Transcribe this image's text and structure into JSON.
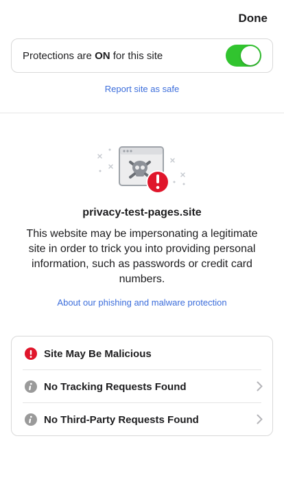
{
  "header": {
    "done_label": "Done"
  },
  "protections": {
    "prefix": "Protections are ",
    "state": "ON",
    "suffix": " for this site",
    "enabled": true
  },
  "report_link": "Report site as safe",
  "site": {
    "name": "privacy-test-pages.site",
    "warning": "This website may be impersonating a legitimate site in order to trick you into providing personal information, such as passwords or credit card numbers.",
    "about_link": "About our phishing and malware protection"
  },
  "status_list": [
    {
      "label": "Site May Be Malicious",
      "icon": "alert-icon",
      "has_chevron": false
    },
    {
      "label": "No Tracking Requests Found",
      "icon": "info-icon",
      "has_chevron": true
    },
    {
      "label": "No Third-Party Requests Found",
      "icon": "info-icon",
      "has_chevron": true
    }
  ],
  "colors": {
    "toggle_on": "#31c42f",
    "link": "#3b6ddb",
    "alert": "#e0162b",
    "info_icon": "#9a9a9a"
  }
}
